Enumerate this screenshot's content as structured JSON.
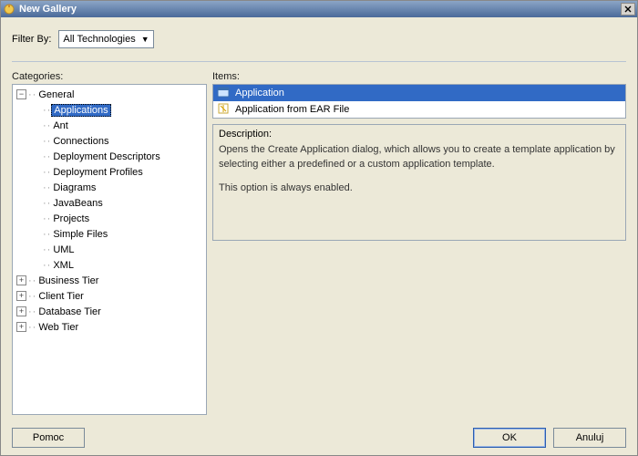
{
  "window": {
    "title": "New Gallery"
  },
  "filter": {
    "label": "Filter By:",
    "selected": "All Technologies"
  },
  "panels": {
    "categories_label": "Categories:",
    "items_label": "Items:",
    "description_label": "Description:"
  },
  "tree": [
    {
      "label": "General",
      "depth": 0,
      "expander": "minus",
      "selected": false
    },
    {
      "label": "Applications",
      "depth": 1,
      "expander": "none",
      "selected": true
    },
    {
      "label": "Ant",
      "depth": 1,
      "expander": "none",
      "selected": false
    },
    {
      "label": "Connections",
      "depth": 1,
      "expander": "none",
      "selected": false
    },
    {
      "label": "Deployment Descriptors",
      "depth": 1,
      "expander": "none",
      "selected": false
    },
    {
      "label": "Deployment Profiles",
      "depth": 1,
      "expander": "none",
      "selected": false
    },
    {
      "label": "Diagrams",
      "depth": 1,
      "expander": "none",
      "selected": false
    },
    {
      "label": "JavaBeans",
      "depth": 1,
      "expander": "none",
      "selected": false
    },
    {
      "label": "Projects",
      "depth": 1,
      "expander": "none",
      "selected": false
    },
    {
      "label": "Simple Files",
      "depth": 1,
      "expander": "none",
      "selected": false
    },
    {
      "label": "UML",
      "depth": 1,
      "expander": "none",
      "selected": false
    },
    {
      "label": "XML",
      "depth": 1,
      "expander": "none",
      "selected": false
    },
    {
      "label": "Business Tier",
      "depth": 0,
      "expander": "plus",
      "selected": false
    },
    {
      "label": "Client Tier",
      "depth": 0,
      "expander": "plus",
      "selected": false
    },
    {
      "label": "Database Tier",
      "depth": 0,
      "expander": "plus",
      "selected": false
    },
    {
      "label": "Web Tier",
      "depth": 0,
      "expander": "plus",
      "selected": false
    }
  ],
  "items": [
    {
      "label": "Application",
      "icon": "app-icon",
      "selected": true
    },
    {
      "label": "Application from EAR File",
      "icon": "wizard-icon",
      "selected": false
    }
  ],
  "description": {
    "text1": "Opens the Create Application dialog, which allows you to create a template application by selecting either a predefined or a custom application template.",
    "text2": "This option is always enabled."
  },
  "buttons": {
    "help": "Pomoc",
    "ok": "OK",
    "cancel": "Anuluj"
  }
}
